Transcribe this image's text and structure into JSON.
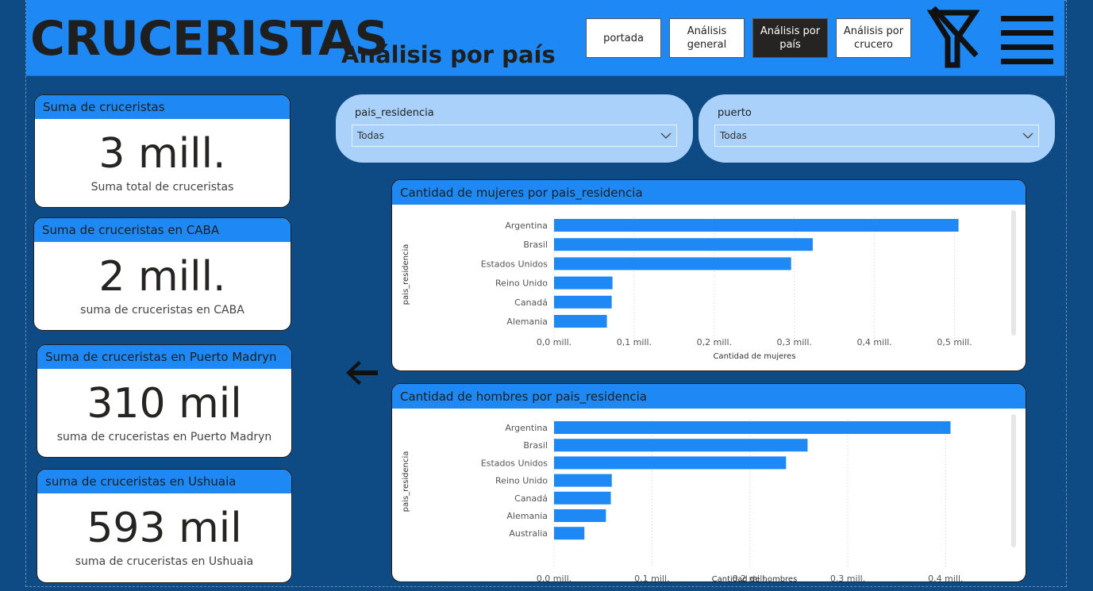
{
  "header": {
    "title": "CRUCERISTAS",
    "subtitle": "Análisis por país",
    "nav": [
      {
        "label": "portada",
        "active": false
      },
      {
        "label": "Análisis general",
        "active": false
      },
      {
        "label": "Análisis por país",
        "active": true
      },
      {
        "label": "Análisis por crucero",
        "active": false
      }
    ],
    "icons": [
      "clear-filter-icon",
      "hamburger-menu-icon"
    ]
  },
  "cards": [
    {
      "title": "Suma de cruceristas",
      "value": "3 mill.",
      "label": "Suma total de cruceristas"
    },
    {
      "title": "Suma de cruceristas en CABA",
      "value": "2 mill.",
      "label": "suma de cruceristas en CABA"
    },
    {
      "title": "Suma de cruceristas en Puerto Madryn",
      "value": "310 mil",
      "label": "suma de cruceristas en Puerto Madryn"
    },
    {
      "title": "suma de cruceristas en Ushuaia",
      "value": "593 mil",
      "label": "suma de cruceristas en Ushuaia"
    }
  ],
  "slicers": [
    {
      "title": "pais_residencia",
      "value": "Todas"
    },
    {
      "title": "puerto",
      "value": "Todas"
    }
  ],
  "colors": {
    "accent": "#1e88f5",
    "background": "#0e4a83",
    "bar": "#1e88f5",
    "slicer": "#a9d1fa"
  },
  "chart_data": [
    {
      "type": "bar",
      "orientation": "horizontal",
      "title": "Cantidad de mujeres por pais_residencia",
      "xlabel": "Cantidad de mujeres",
      "ylabel": "pais_residencia",
      "categories": [
        "Argentina",
        "Brasil",
        "Estados Unidos",
        "Reino Unido",
        "Canadá",
        "Alemania"
      ],
      "values": [
        505000,
        323000,
        296000,
        73000,
        72000,
        66000
      ],
      "xlim": [
        0,
        550000
      ],
      "ticks": [
        0,
        100000,
        200000,
        300000,
        400000,
        500000
      ],
      "tick_labels": [
        "0,0 mill.",
        "0,1 mill.",
        "0,2 mill.",
        "0,3 mill.",
        "0,4 mill.",
        "0,5 mill."
      ],
      "grid": true
    },
    {
      "type": "bar",
      "orientation": "horizontal",
      "title": "Cantidad de hombres por pais_residencia",
      "xlabel": "Cantidad de hombres",
      "ylabel": "pais_residencia",
      "categories": [
        "Argentina",
        "Brasil",
        "Estados Unidos",
        "Reino Unido",
        "Canadá",
        "Alemania",
        "Australia"
      ],
      "values": [
        405000,
        259000,
        237000,
        59000,
        58000,
        53000,
        31000
      ],
      "xlim": [
        0,
        450000
      ],
      "ticks": [
        0,
        100000,
        200000,
        300000,
        400000
      ],
      "tick_labels": [
        "0,0 mill.",
        "0,1 mill.",
        "0,2 mill.",
        "0,3 mill.",
        "0,4 mill."
      ],
      "grid": true
    }
  ]
}
